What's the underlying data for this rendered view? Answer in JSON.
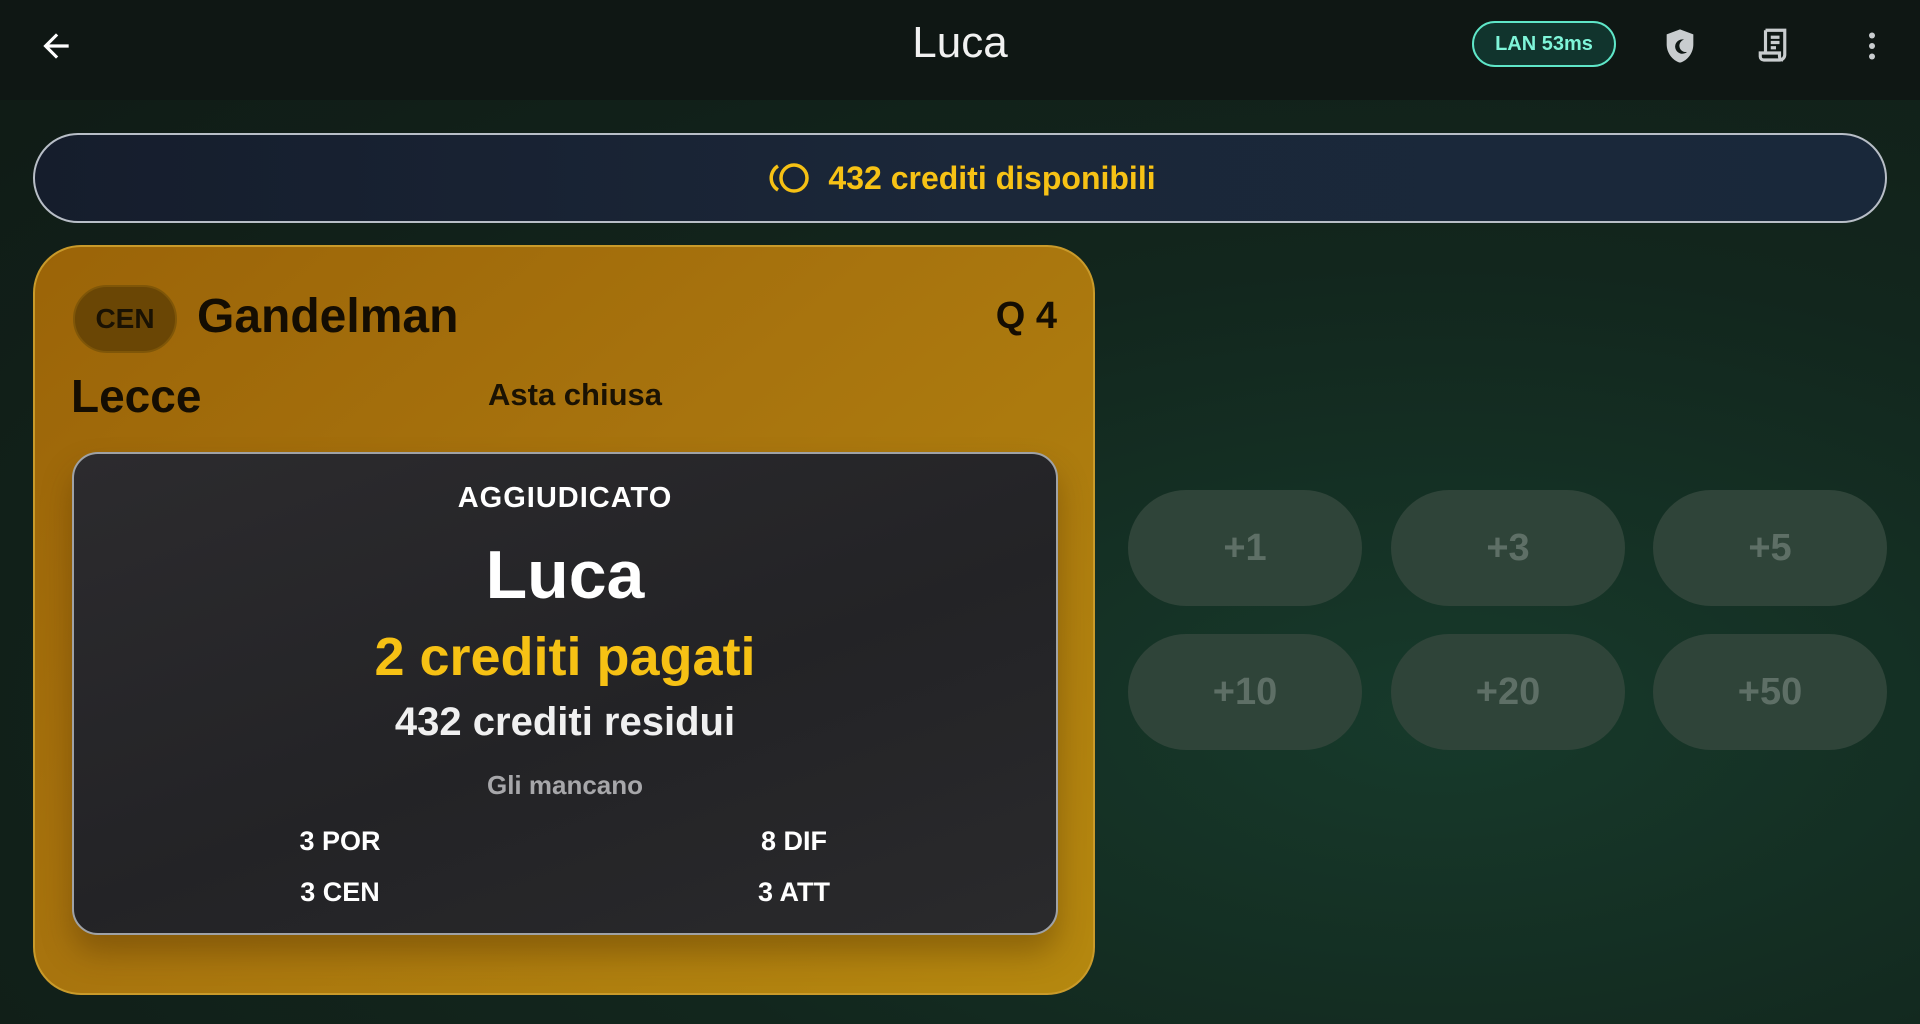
{
  "header": {
    "title": "Luca",
    "back_icon": "arrow-left-icon",
    "connection_badge": "LAN 53ms",
    "actions": [
      {
        "icon": "shield-moon-icon"
      },
      {
        "icon": "receipt-icon"
      },
      {
        "icon": "more-vertical-icon"
      }
    ]
  },
  "credits": {
    "icon": "coins-icon",
    "text": "432 crediti disponibili"
  },
  "player": {
    "role": "CEN",
    "name": "Gandelman",
    "quote": "Q 4",
    "team": "Lecce",
    "auction_status": "Asta chiusa"
  },
  "result": {
    "label": "AGGIUDICATO",
    "winner": "Luca",
    "paid": "2 crediti pagati",
    "residual": "432 crediti residui",
    "missing_label": "Gli mancano",
    "needs": [
      "3 POR",
      "8 DIF",
      "3 CEN",
      "3 ATT"
    ]
  },
  "bids": [
    "+1",
    "+3",
    "+5",
    "+10",
    "+20",
    "+50"
  ],
  "colors": {
    "accent": "#f6c114",
    "card": "#a8740e",
    "badge": "#5fe6c8"
  }
}
